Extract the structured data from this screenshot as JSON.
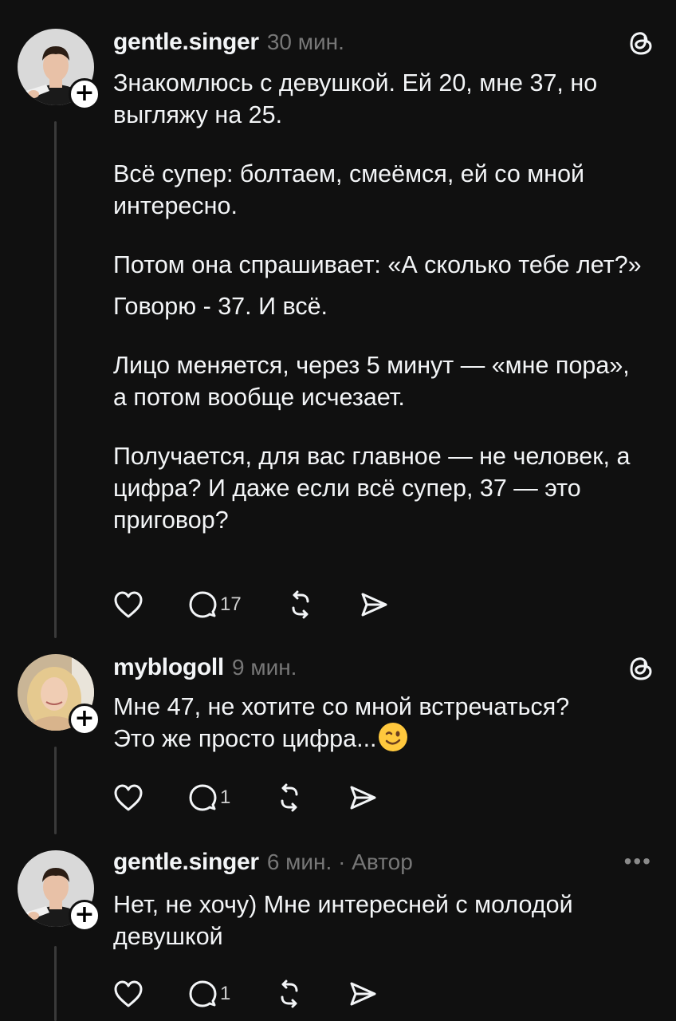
{
  "posts": [
    {
      "username": "gentle.singer",
      "time": "30 мин.",
      "paragraphs": [
        "Знакомлюсь с девушкой. Ей 20, мне 37, но выгляжу на 25.",
        "Всё супер: болтаем, смеёмся, ей со мной интересно.",
        "Потом она спрашивает: «А сколько тебе лет?»",
        "Говорю - 37. И всё.",
        "Лицо меняется, через 5 минут — «мне пора», а потом вообще исчезает.",
        "Получается, для вас главное — не человек, а цифра? И даже если всё супер, 37 — это приговор?"
      ],
      "replies_count": "17",
      "follow_icon": "plus-icon",
      "corner_icon": "threads-logo-icon"
    },
    {
      "username": "myblogoll",
      "time": "9 мин.",
      "text_line1": "Мне 47, не хотите со мной встречаться?",
      "text_line2": "Это же просто цифра...",
      "emoji_icon": "winking-face-icon",
      "replies_count": "1",
      "follow_icon": "plus-icon",
      "corner_icon": "threads-logo-icon"
    },
    {
      "username": "gentle.singer",
      "time": "6 мин. · Автор",
      "text_line1": "Нет, не хочу) Мне интересней с молодой",
      "text_line2": "девушкой",
      "replies_count": "1",
      "follow_icon": "plus-icon",
      "corner_icon": "more-icon",
      "more_label": "•••"
    }
  ],
  "colors": {
    "background": "#101010",
    "text": "#f3f5f7",
    "muted": "#777777",
    "thread_line": "#3a3a3a"
  }
}
